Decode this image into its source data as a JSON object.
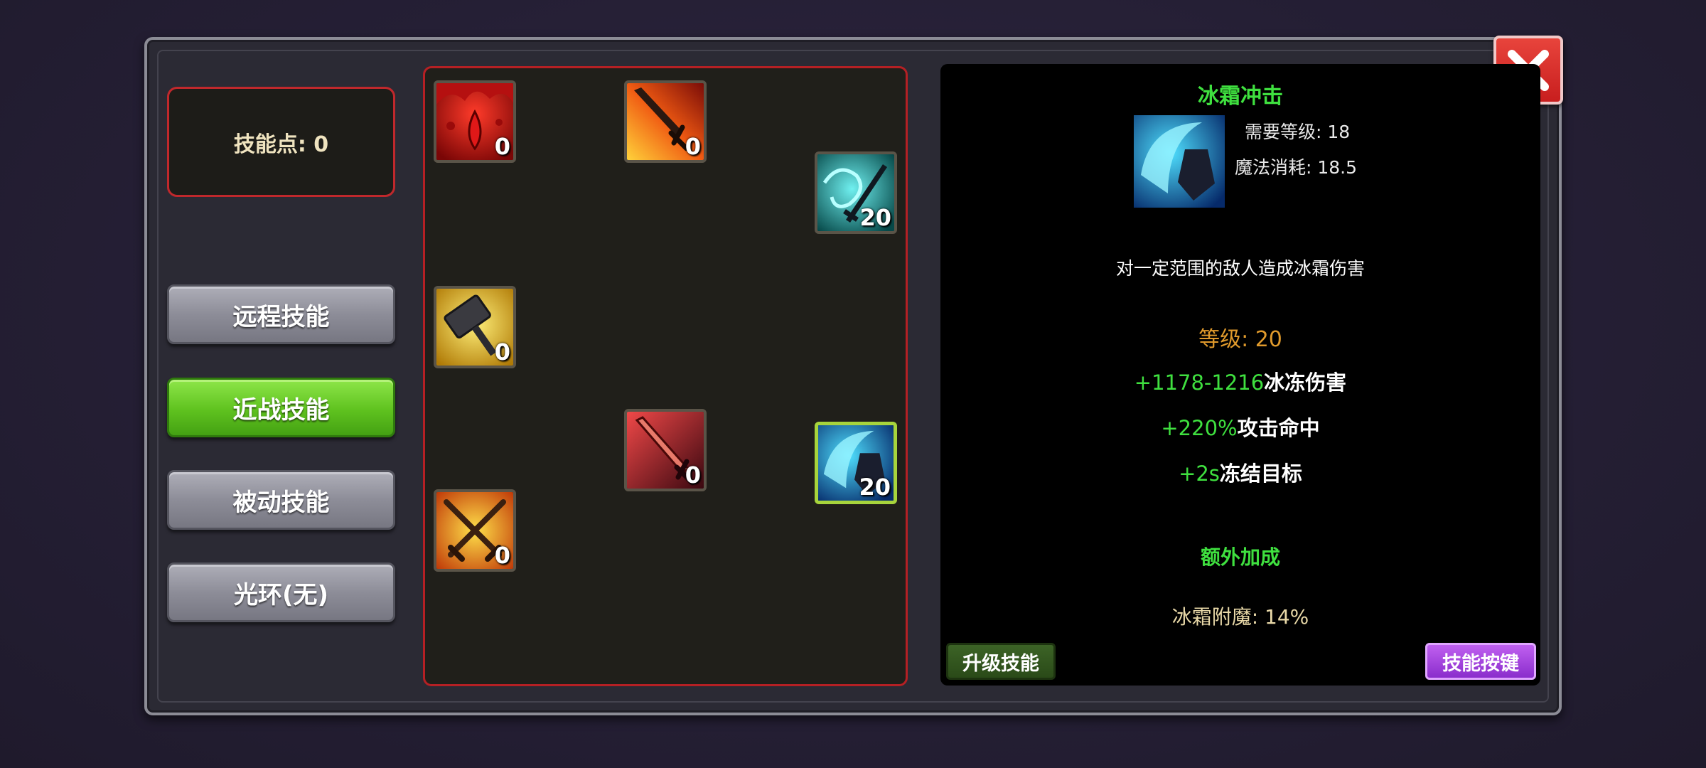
{
  "skill_points": {
    "label": "技能点: 0"
  },
  "tabs": [
    {
      "label": "远程技能",
      "active": false
    },
    {
      "label": "近战技能",
      "active": true
    },
    {
      "label": "被动技能",
      "active": false
    },
    {
      "label": "光环(无)",
      "active": false
    }
  ],
  "skills": [
    {
      "icon": "blood-drop-icon",
      "level": "0"
    },
    {
      "icon": "flaming-sword-icon",
      "level": "0"
    },
    {
      "icon": "ice-sword-icon",
      "level": "20"
    },
    {
      "icon": "golden-hammer-icon",
      "level": "0"
    },
    {
      "icon": "crimson-blade-icon",
      "level": "0"
    },
    {
      "icon": "frost-strike-icon",
      "level": "20",
      "selected": true
    },
    {
      "icon": "crossed-swords-icon",
      "level": "0"
    }
  ],
  "detail": {
    "name": "冰霜冲击",
    "icon": "frost-strike-icon",
    "required_level": "需要等级: 18",
    "mana_cost": "魔法消耗: 18.5",
    "description": "对一定范围的敌人造成冰霜伤害",
    "level": "等级: 20",
    "stats": [
      {
        "value": "+1178-1216",
        "text": "冰冻伤害"
      },
      {
        "value": "+220%",
        "text": "攻击命中"
      },
      {
        "value": "+2s",
        "text": "冻结目标"
      }
    ],
    "bonus_title": "额外加成",
    "bonus": "冰霜附魔: 14%",
    "upgrade_label": "升级技能",
    "keybind_label": "技能按键"
  },
  "colors": {
    "accent_green": "#3fe03f",
    "tab_active": "#5fc21f",
    "border_red": "#c0282c",
    "keybind_purple": "#a845e0"
  }
}
